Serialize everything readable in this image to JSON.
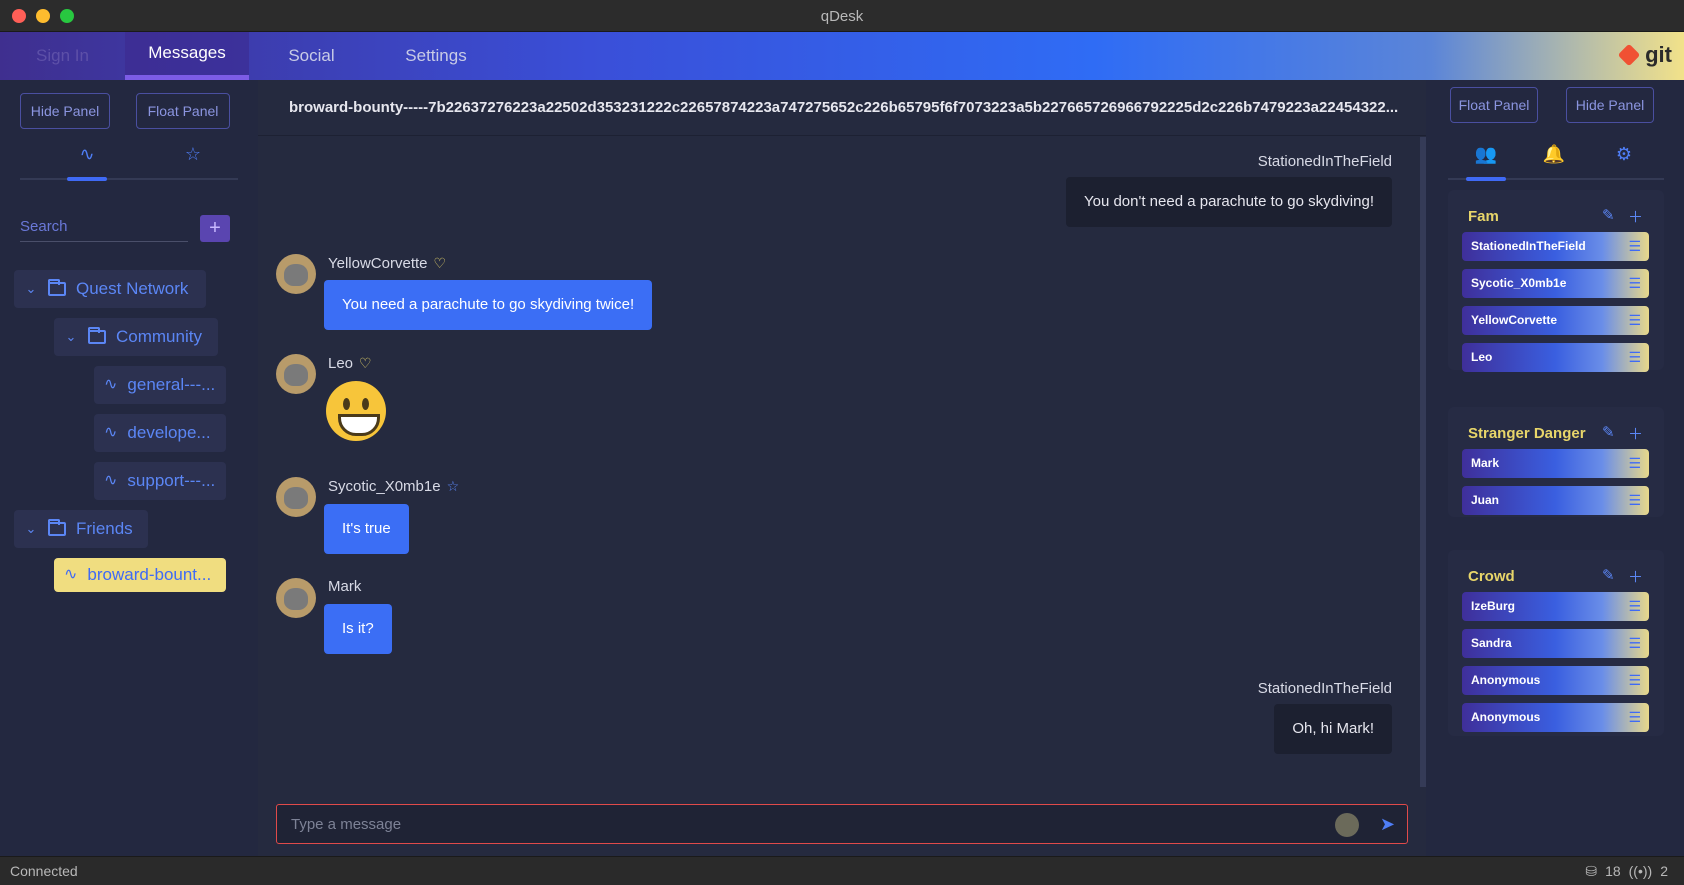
{
  "window": {
    "title": "qDesk"
  },
  "nav": {
    "tabs": [
      {
        "label": "Sign In"
      },
      {
        "label": "Messages"
      },
      {
        "label": "Social"
      },
      {
        "label": "Settings"
      }
    ],
    "brand": "git"
  },
  "left": {
    "hide_panel": "Hide Panel",
    "float_panel": "Float Panel",
    "search_placeholder": "Search",
    "plus": "+",
    "tree": [
      {
        "label": "Quest Network"
      },
      {
        "label": "Community"
      },
      {
        "label": "general---..."
      },
      {
        "label": "develope..."
      },
      {
        "label": "support---..."
      },
      {
        "label": "Friends"
      },
      {
        "label": "broward-bount..."
      }
    ]
  },
  "chat": {
    "channel_title": "broward-bounty-----7b22637276223a22502d353231222c22657874223a747275652c226b65795f6f7073223a5b227665726966792225d2c226b7479223a22454322...",
    "messages": [
      {
        "sender": "StationedInTheField",
        "text": "You don't need a parachute to go skydiving!"
      },
      {
        "sender": "YellowCorvette",
        "text": "You need a parachute to go skydiving twice!"
      },
      {
        "sender": "Leo",
        "text": ""
      },
      {
        "sender": "Sycotic_X0mb1e",
        "text": "It's true"
      },
      {
        "sender": "Mark",
        "text": "Is it?"
      },
      {
        "sender": "StationedInTheField",
        "text": "Oh, hi Mark!"
      }
    ],
    "input_placeholder": "Type a message"
  },
  "right": {
    "float_panel": "Float Panel",
    "hide_panel": "Hide Panel",
    "groups": [
      {
        "title": "Fam",
        "members": [
          "StationedInTheField",
          "Sycotic_X0mb1e",
          "YellowCorvette",
          "Leo"
        ]
      },
      {
        "title": "Stranger Danger",
        "members": [
          "Mark",
          "Juan"
        ]
      },
      {
        "title": "Crowd",
        "members": [
          "IzeBurg",
          "Sandra",
          "Anonymous",
          "Anonymous"
        ]
      }
    ]
  },
  "status": {
    "text": "Connected",
    "count1": "18",
    "count2": "2"
  }
}
